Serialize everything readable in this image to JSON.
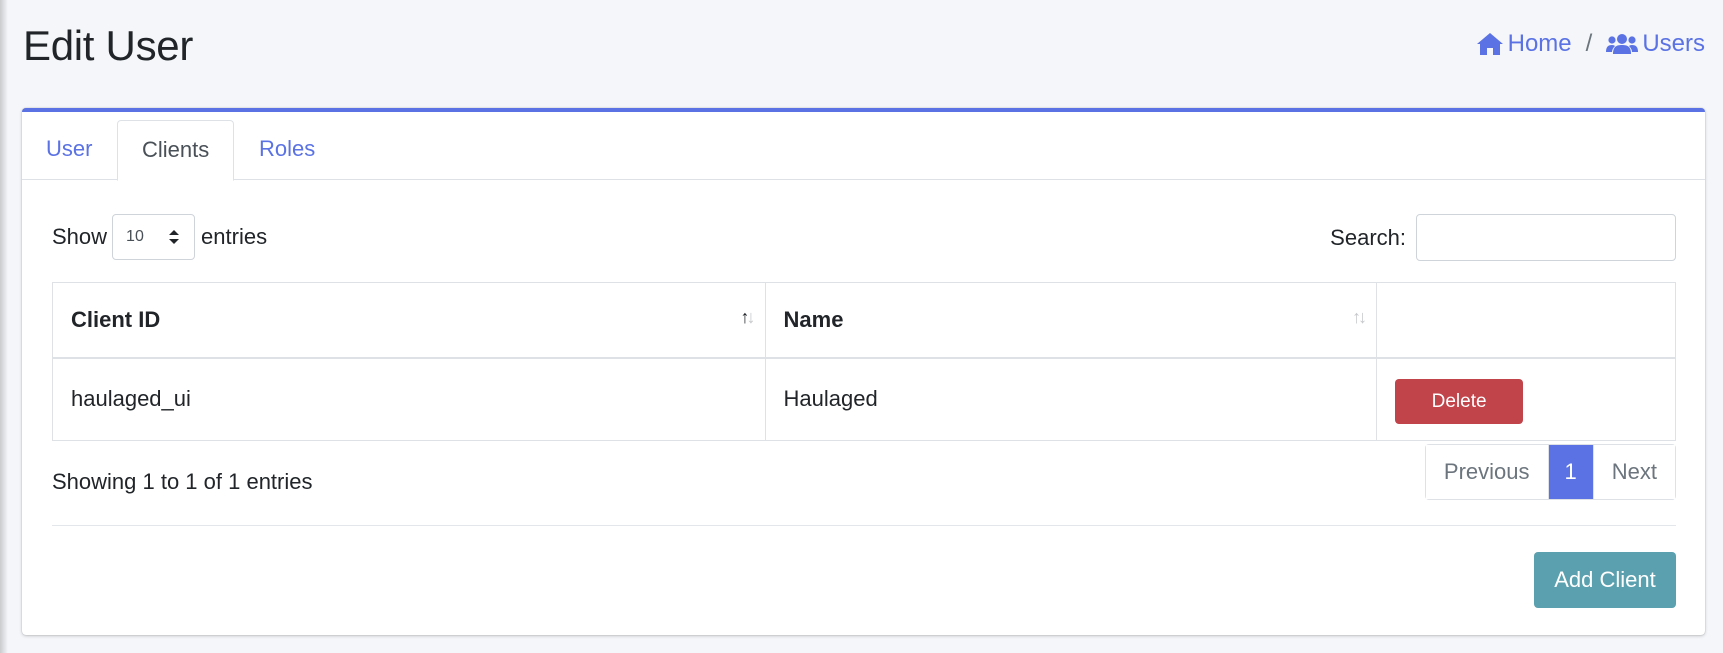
{
  "page": {
    "title": "Edit User"
  },
  "breadcrumb": {
    "home": "Home",
    "separator": "/",
    "users": "Users"
  },
  "tabs": [
    {
      "label": "User",
      "active": false
    },
    {
      "label": "Clients",
      "active": true
    },
    {
      "label": "Roles",
      "active": false
    }
  ],
  "table_controls": {
    "show_label": "Show",
    "entries_label": "entries",
    "page_length": "10",
    "search_label": "Search:",
    "search_value": ""
  },
  "table": {
    "columns": [
      {
        "label": "Client ID",
        "sort": "asc"
      },
      {
        "label": "Name",
        "sort": "none"
      },
      {
        "label": "",
        "sort": "none"
      }
    ],
    "rows": [
      {
        "client_id": "haulaged_ui",
        "name": "Haulaged",
        "action": "Delete"
      }
    ]
  },
  "footer": {
    "info": "Showing 1 to 1 of 1 entries",
    "pagination": {
      "previous": "Previous",
      "current": "1",
      "next": "Next"
    },
    "add_button": "Add Client"
  },
  "colors": {
    "primary": "#5a72e4",
    "danger": "#c0444a",
    "info": "#5aa0ae",
    "background": "#f4f6f9"
  }
}
